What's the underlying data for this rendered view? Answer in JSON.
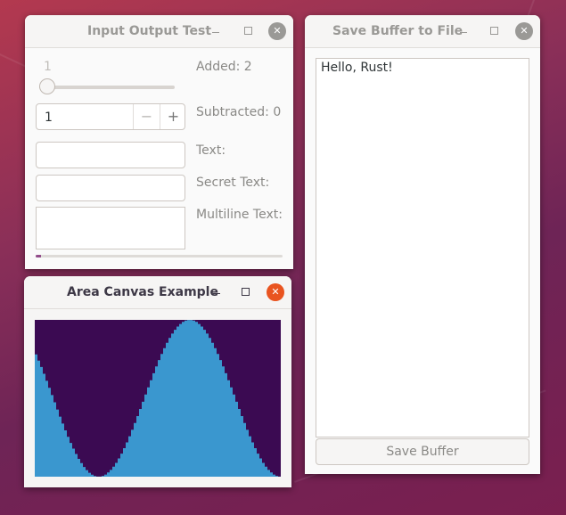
{
  "colors": {
    "plot_background": "#3b0a52",
    "plot_fill": "#3a97cf",
    "progress": "#924d8b",
    "close_active": "#e95420"
  },
  "input_window": {
    "title": "Input Output Test",
    "slider_value": "1",
    "slider_level": 0,
    "added_label": "Added: 2",
    "spin_value": "1",
    "spin_minus": "−",
    "spin_plus": "+",
    "subtracted_label": "Subtracted: 0",
    "text_label": "Text:",
    "secret_label": "Secret Text:",
    "multiline_label": "Multiline Text:",
    "progress_fraction": 0.02
  },
  "save_window": {
    "title": "Save Buffer to File",
    "buffer_text": "Hello, Rust!",
    "save_button": "Save Buffer"
  },
  "canvas_window": {
    "title": "Area Canvas Example"
  },
  "titlebar_icons": {
    "minimize": "minimize-icon",
    "maximize": "maximize-icon",
    "close": "close-icon",
    "close_glyph": "✕"
  }
}
